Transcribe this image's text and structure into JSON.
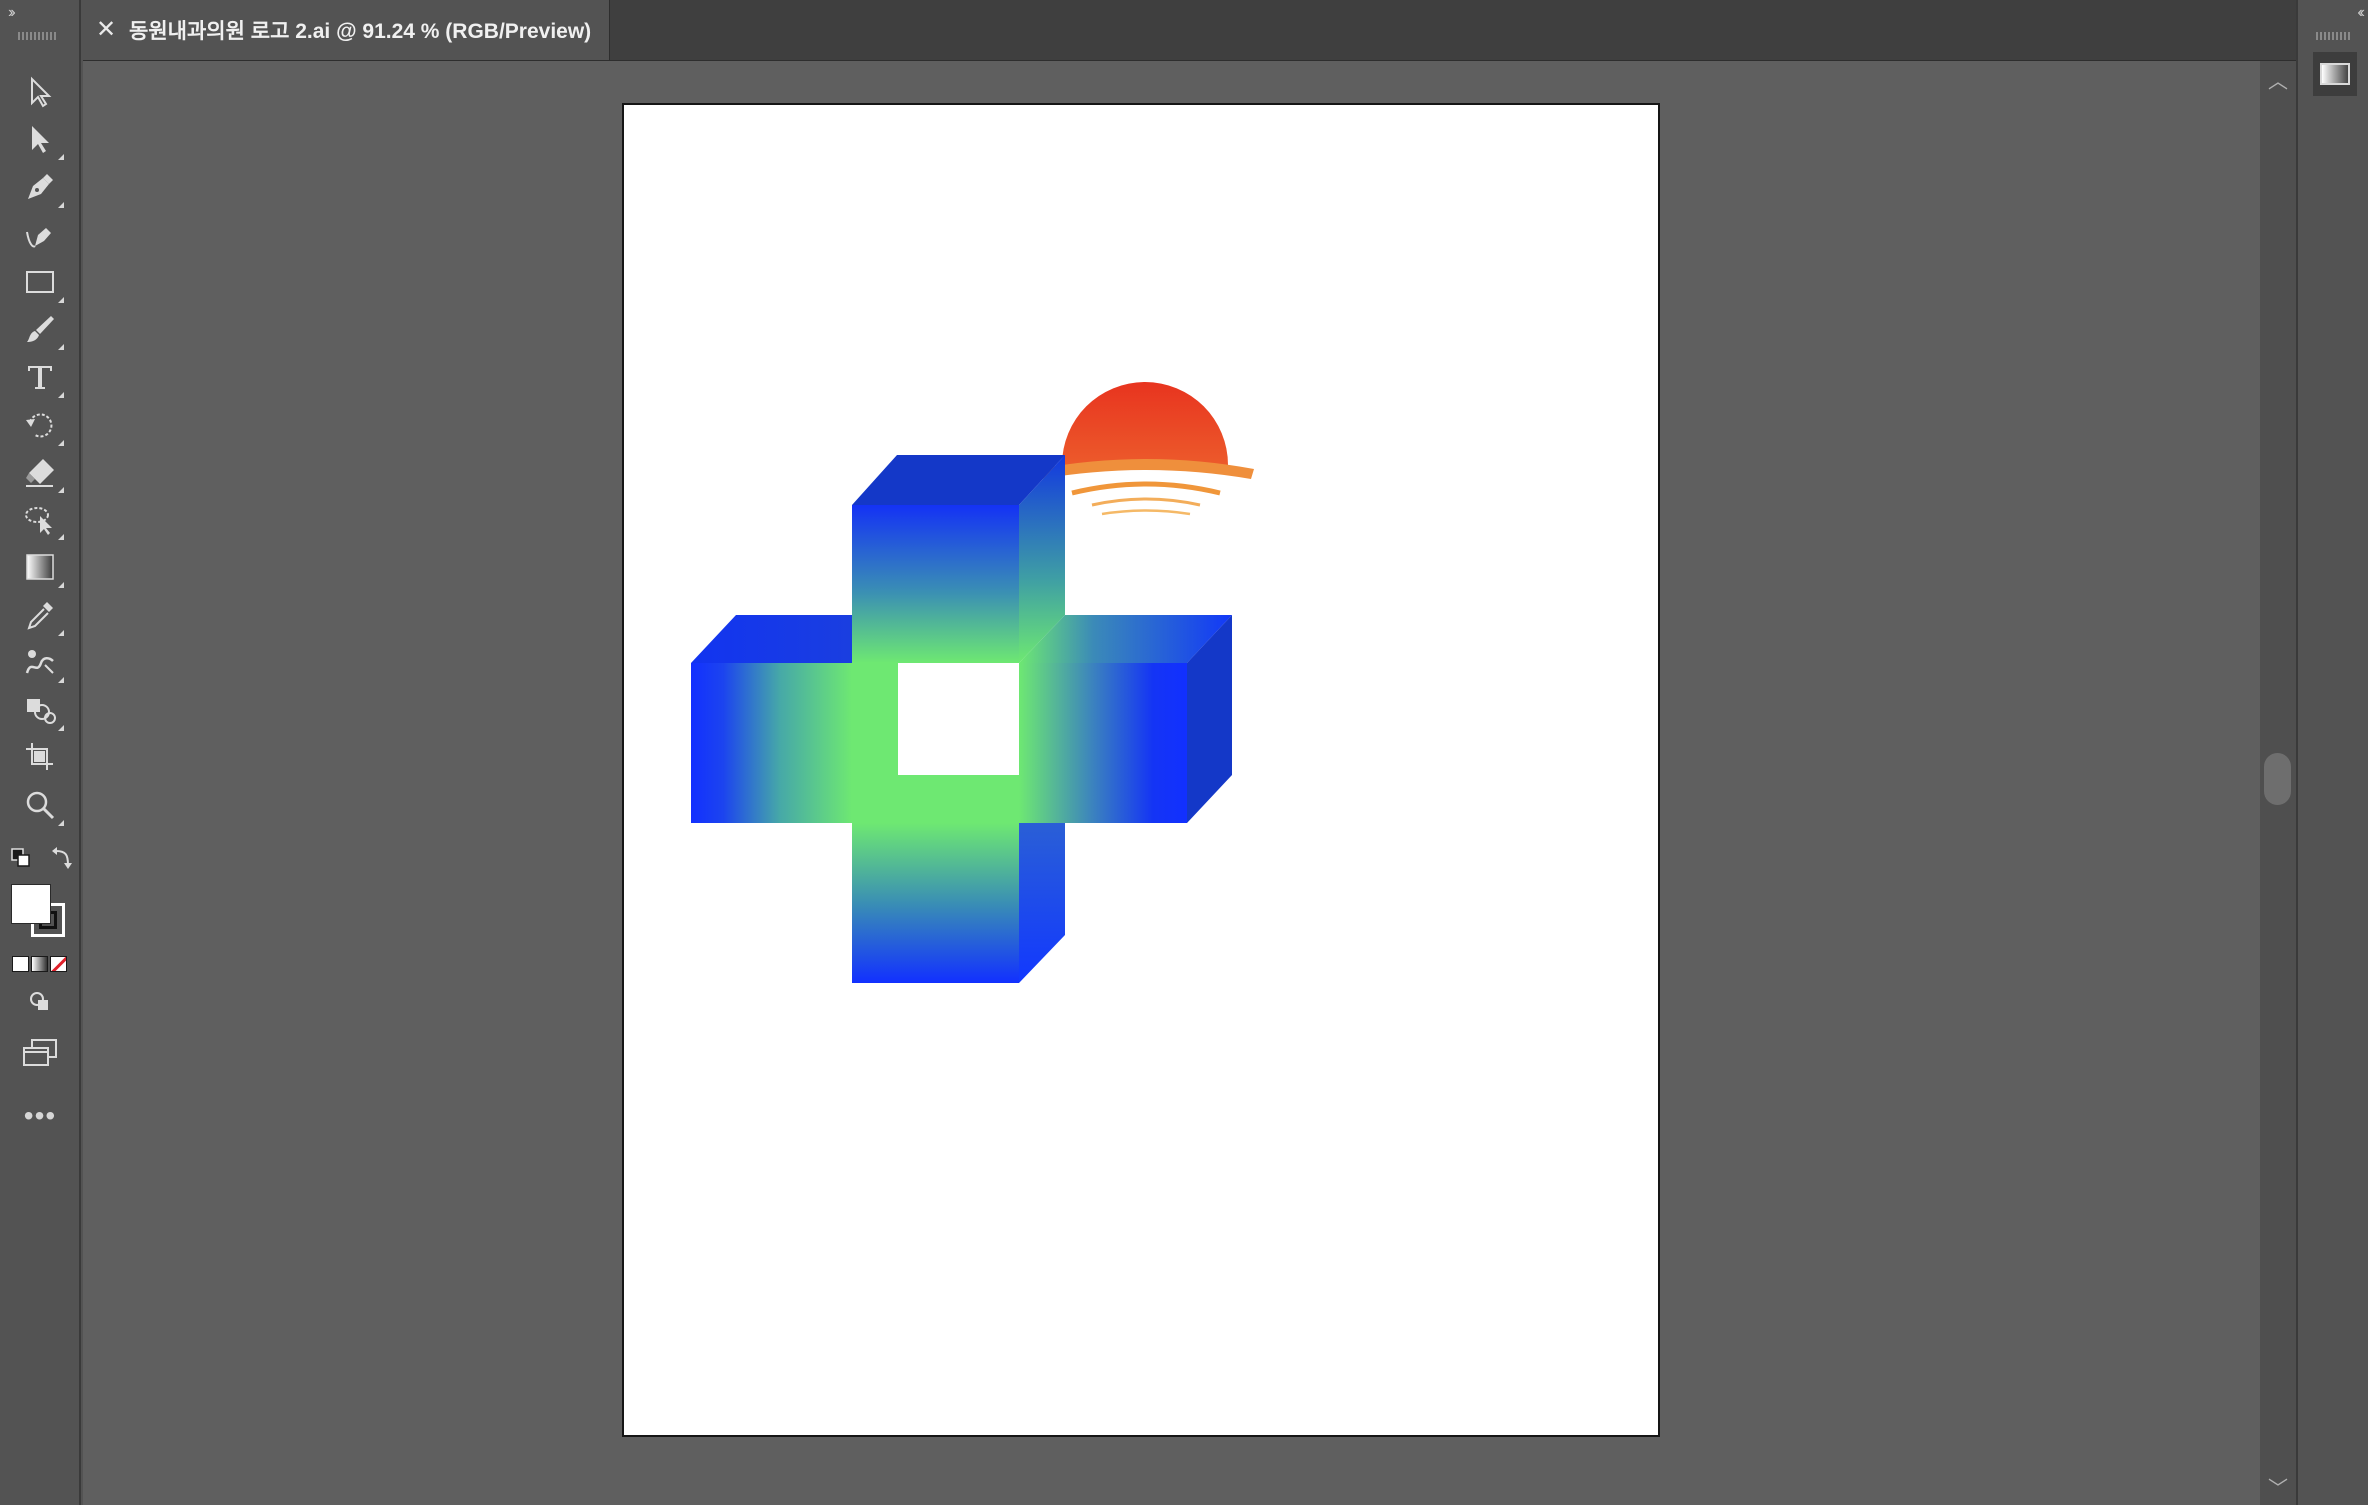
{
  "document_tab": {
    "close_glyph": "✕",
    "title": "동원내과의원 로고 2.ai @ 91.24 % (RGB/Preview)"
  },
  "toolbar": {
    "collapse_glyph": "››",
    "tools": [
      {
        "name": "selection-tool",
        "icon": "arrow-outline-icon"
      },
      {
        "name": "direct-selection-tool",
        "icon": "arrow-filled-icon"
      },
      {
        "name": "pen-tool",
        "icon": "pen-icon"
      },
      {
        "name": "curvature-tool",
        "icon": "curvature-pen-icon"
      },
      {
        "name": "rectangle-tool",
        "icon": "rectangle-icon"
      },
      {
        "name": "paintbrush-tool",
        "icon": "brush-icon"
      },
      {
        "name": "type-tool",
        "icon": "type-icon"
      },
      {
        "name": "rotate-tool",
        "icon": "rotate-icon"
      },
      {
        "name": "eraser-tool",
        "icon": "eraser-icon"
      },
      {
        "name": "puppet-warp-tool",
        "icon": "lasso-select-icon"
      },
      {
        "name": "gradient-tool",
        "icon": "gradient-icon"
      },
      {
        "name": "eyedropper-tool",
        "icon": "eyedropper-icon"
      },
      {
        "name": "blend-tool",
        "icon": "blend-icon"
      },
      {
        "name": "shape-builder-tool",
        "icon": "shape-builder-icon"
      },
      {
        "name": "artboard-tool",
        "icon": "artboard-icon"
      },
      {
        "name": "zoom-tool",
        "icon": "magnifier-icon"
      }
    ],
    "fill_color": "#ffffff",
    "stroke_color": "#000000",
    "more_tools_glyph": "•••"
  },
  "right_panel": {
    "collapse_glyph": "‹‹",
    "panel_icon": "gradient-panel-icon"
  },
  "scrollbar": {
    "up_glyph": "︿",
    "down_glyph": "﹀"
  },
  "artwork": {
    "sun_color": "#e63a22",
    "sun_rays_color": "#f0963a",
    "cross_blue": "#1230ff",
    "cross_green": "#6ee872",
    "cross_dark_blue": "#1438c8"
  }
}
